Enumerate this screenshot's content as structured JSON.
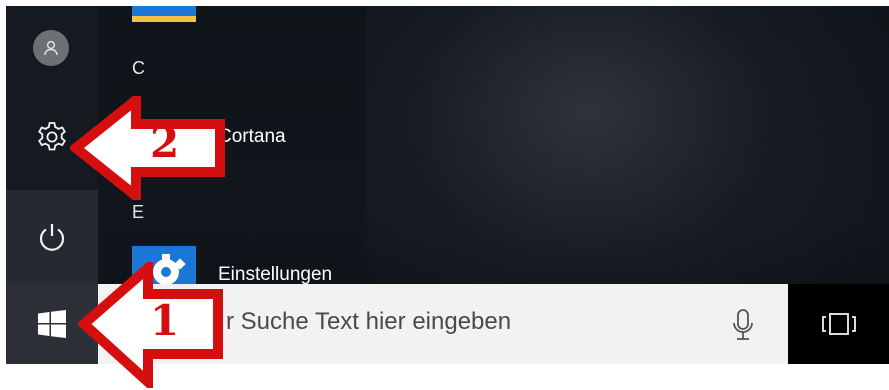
{
  "start_menu": {
    "group_c": "C",
    "app_cortana": "Cortana",
    "group_e": "E",
    "app_settings": "Einstellungen"
  },
  "rail": {
    "icons": [
      "user-icon",
      "gear-icon",
      "power-icon"
    ]
  },
  "taskbar": {
    "start_icon": "windows-logo-icon",
    "search_placeholder": "r Suche Text hier eingeben",
    "mic_icon": "microphone-icon",
    "taskview_icon": "task-view-icon"
  },
  "annotations": {
    "arrow_1_label": "1",
    "arrow_2_label": "2",
    "arrow_color": "#d50f0f"
  },
  "colors": {
    "accent": "#1a77d4",
    "taskbar_black": "#000000",
    "search_bg": "#f2f2f2"
  }
}
